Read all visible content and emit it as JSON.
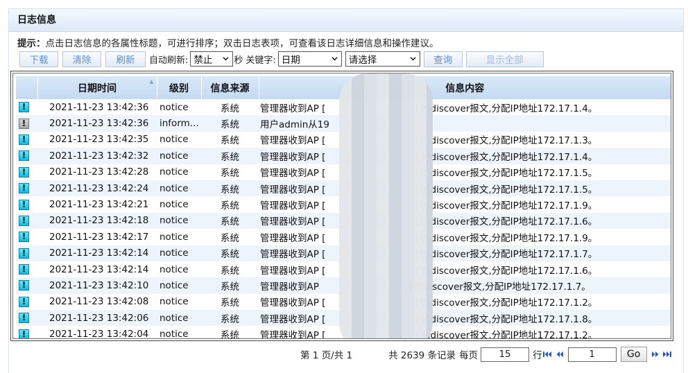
{
  "panel": {
    "title": "日志信息"
  },
  "tip": {
    "label": "提示：",
    "text": "点击日志信息的各属性标题，可进行排序；双击日志表项，可查看该日志详细信息和操作建议。"
  },
  "toolbar": {
    "download_label": "下载",
    "clear_label": "清除",
    "refresh_label": "刷新",
    "auto_refresh_label": "自动刷新:",
    "auto_refresh_value": "禁止",
    "seconds_label": "秒",
    "keyword_label": "关键字:",
    "keyword_field": "日期",
    "keyword_value": "请选择",
    "query_label": "查询",
    "show_all_label": "显示全部"
  },
  "table": {
    "columns": [
      "",
      "日期时间",
      "级别",
      "信息来源",
      "信息内容"
    ],
    "rows": [
      {
        "icon": "notice-icon",
        "date": "2021-11-23 13:42:36",
        "level": "notice",
        "source": "系统",
        "msg_pre": "管理器收到AP [",
        "msg_post": "] 的discover报文,分配IP地址172.17.1.4。"
      },
      {
        "icon": "info-icon",
        "date": "2021-11-23 13:42:36",
        "level": "inform...",
        "source": "系统",
        "msg_pre": "用户admin从19",
        "msg_post": ""
      },
      {
        "icon": "notice-icon",
        "date": "2021-11-23 13:42:35",
        "level": "notice",
        "source": "系统",
        "msg_pre": "管理器收到AP [",
        "msg_post": "] 的discover报文,分配IP地址172.17.1.3。"
      },
      {
        "icon": "notice-icon",
        "date": "2021-11-23 13:42:32",
        "level": "notice",
        "source": "系统",
        "msg_pre": "管理器收到AP [",
        "msg_post": "] 的discover报文,分配IP地址172.17.1.4。"
      },
      {
        "icon": "notice-icon",
        "date": "2021-11-23 13:42:28",
        "level": "notice",
        "source": "系统",
        "msg_pre": "管理器收到AP [",
        "msg_post": "] 的discover报文,分配IP地址172.17.1.5。"
      },
      {
        "icon": "notice-icon",
        "date": "2021-11-23 13:42:24",
        "level": "notice",
        "source": "系统",
        "msg_pre": "管理器收到AP [",
        "msg_post": "] 的discover报文,分配IP地址172.17.1.5。"
      },
      {
        "icon": "notice-icon",
        "date": "2021-11-23 13:42:21",
        "level": "notice",
        "source": "系统",
        "msg_pre": "管理器收到AP [",
        "msg_post": "] 的discover报文,分配IP地址172.17.1.9。"
      },
      {
        "icon": "notice-icon",
        "date": "2021-11-23 13:42:18",
        "level": "notice",
        "source": "系统",
        "msg_pre": "管理器收到AP [",
        "msg_post": "] 的discover报文,分配IP地址172.17.1.6。"
      },
      {
        "icon": "notice-icon",
        "date": "2021-11-23 13:42:17",
        "level": "notice",
        "source": "系统",
        "msg_pre": "管理器收到AP [",
        "msg_post": "] 的discover报文,分配IP地址172.17.1.9。"
      },
      {
        "icon": "notice-icon",
        "date": "2021-11-23 13:42:14",
        "level": "notice",
        "source": "系统",
        "msg_pre": "管理器收到AP [",
        "msg_post": "] 的discover报文,分配IP地址172.17.1.7。"
      },
      {
        "icon": "notice-icon",
        "date": "2021-11-23 13:42:14",
        "level": "notice",
        "source": "系统",
        "msg_pre": "管理器收到AP [",
        "msg_post": "] 的discover报文,分配IP地址172.17.1.6。"
      },
      {
        "icon": "notice-icon",
        "date": "2021-11-23 13:42:10",
        "level": "notice",
        "source": "系统",
        "msg_pre": "管理器收到AP",
        "msg_post": "] 的discover报文,分配IP地址172.17.1.7。"
      },
      {
        "icon": "notice-icon",
        "date": "2021-11-23 13:42:08",
        "level": "notice",
        "source": "系统",
        "msg_pre": "管理器收到AP [",
        "msg_post": "] 的discover报文,分配IP地址172.17.1.2。"
      },
      {
        "icon": "notice-icon",
        "date": "2021-11-23 13:42:06",
        "level": "notice",
        "source": "系统",
        "msg_pre": "管理器收到AP [",
        "msg_post": "] 的discover报文,分配IP地址172.17.1.8。"
      },
      {
        "icon": "notice-icon",
        "date": "2021-11-23 13:42:04",
        "level": "notice",
        "source": "系统",
        "msg_pre": "管理器收到AP [",
        "msg_post": "] 的discover报文,分配IP地址172.17.1.2。"
      }
    ]
  },
  "pager": {
    "page_prefix": "第 1 页/共 1",
    "total_text": "共 2639 条记录",
    "per_page_label": "每页",
    "per_page_value": "15",
    "rows_label": "行",
    "page_input_value": "1",
    "go_label": "Go"
  },
  "colors": {
    "header_bg": "#dde9f7",
    "button_text": "#5b8fd0",
    "notice_icon": "#1ec8ec",
    "row_alt": "#eef4fb"
  }
}
